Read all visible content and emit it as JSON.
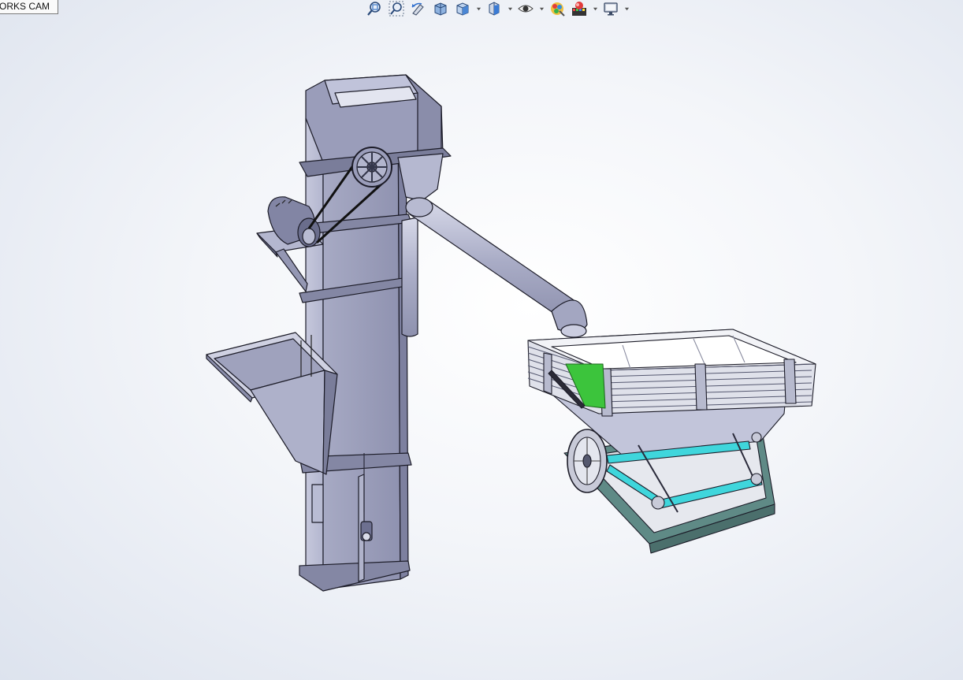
{
  "tab": {
    "label": "ORKS CAM"
  },
  "heads_up_toolbar": {
    "buttons": [
      {
        "name": "zoom-to-fit-icon",
        "dropdown": false
      },
      {
        "name": "zoom-to-area-icon",
        "dropdown": false
      },
      {
        "name": "previous-view-icon",
        "dropdown": false
      },
      {
        "name": "section-view-icon",
        "dropdown": false
      },
      {
        "name": "view-orientation-icon",
        "dropdown": true
      },
      {
        "name": "display-style-icon",
        "dropdown": true
      },
      {
        "name": "hide-show-items-icon",
        "dropdown": true
      },
      {
        "name": "edit-appearance-icon",
        "dropdown": false
      },
      {
        "name": "apply-scene-icon",
        "dropdown": true
      },
      {
        "name": "view-settings-icon",
        "dropdown": true
      }
    ]
  },
  "viewport": {
    "model": "bucket-elevator-with-vibrating-screen",
    "colors": {
      "steel": "#9fa2bd",
      "steel_dark": "#7c7f9c",
      "steel_light": "#c3c6dc",
      "accent_green": "#3cc43c",
      "accent_cyan": "#3fd6dc",
      "base_teal": "#5f8a86"
    }
  }
}
